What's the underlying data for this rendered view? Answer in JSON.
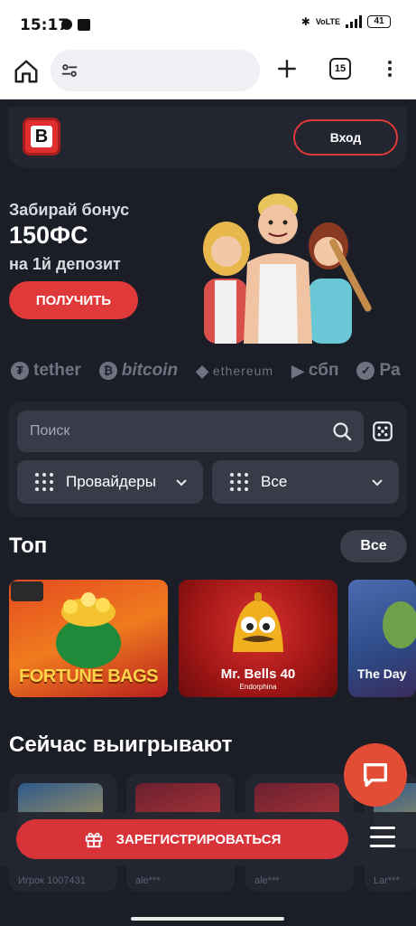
{
  "status_bar": {
    "time": "15:17",
    "battery": "41"
  },
  "browser": {
    "tab_count": "15"
  },
  "header": {
    "login_label": "Вход",
    "logo_letter": "B"
  },
  "promo": {
    "line1": "Забирай бонус",
    "line2": "150ФС",
    "line3": "на 1й депозит",
    "cta_label": "ПОЛУЧИТЬ"
  },
  "payments": [
    "tether",
    "bitcoin",
    "ethereum",
    "сбп",
    "Pa"
  ],
  "filters": {
    "search_placeholder": "Поиск",
    "providers_label": "Провайдеры",
    "category_label": "Все"
  },
  "top": {
    "title": "Топ",
    "all_label": "Все",
    "games": [
      {
        "title": "FORTUNE BAGS",
        "subtitle": ""
      },
      {
        "title": "Mr. Bells 40",
        "subtitle": "Endorphina"
      },
      {
        "title": "The Day",
        "subtitle": ""
      }
    ]
  },
  "winners": {
    "title": "Сейчас выигрывают",
    "items": [
      {
        "user": "Игрок 1007431"
      },
      {
        "user": "ale***"
      },
      {
        "user": "ale***"
      },
      {
        "user": "Lar***"
      }
    ]
  },
  "bottom": {
    "register_label": "ЗАРЕГИСТРИРОВАТЬСЯ"
  },
  "colors": {
    "accent": "#e0393a",
    "background": "#1b1e27",
    "panel": "#232631",
    "field": "#383c49"
  }
}
